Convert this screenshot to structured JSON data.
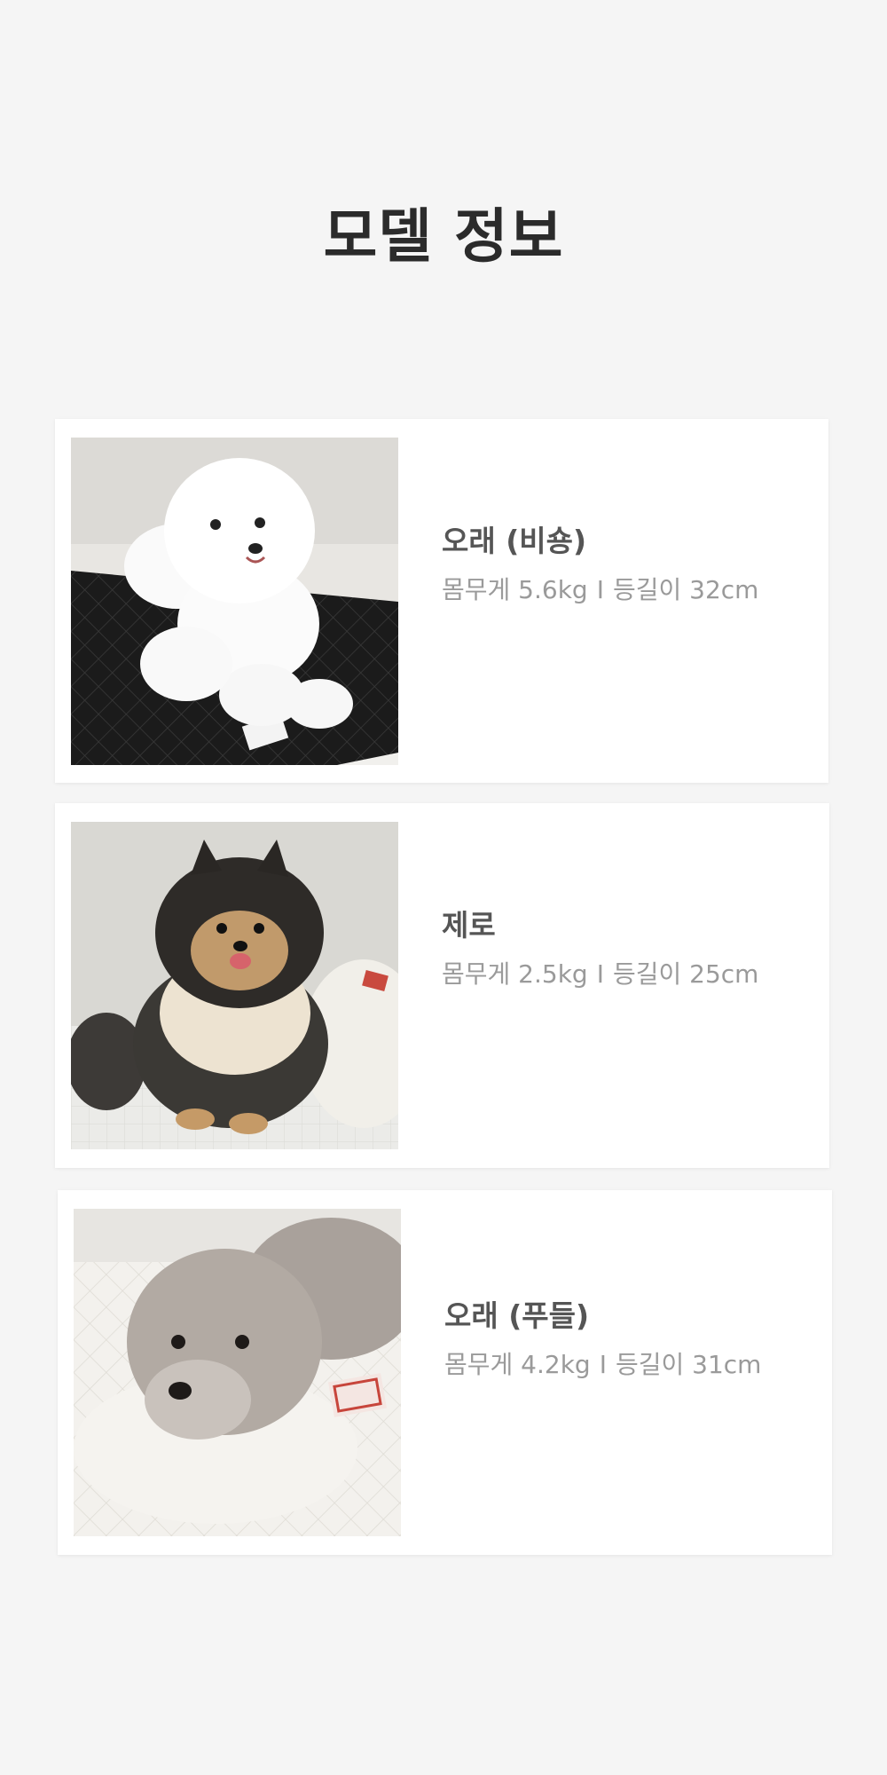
{
  "page": {
    "title": "모델 정보",
    "background": "#f5f5f5"
  },
  "models": [
    {
      "name": "오래 (비숑)",
      "weight": "몸무게 5.6kg",
      "separator": "I",
      "length": "등길이 32cm",
      "photo": "bichon-on-black-quilted-mat"
    },
    {
      "name": "제로",
      "weight": "몸무게 2.5kg",
      "separator": "I",
      "length": "등길이 25cm",
      "photo": "pomeranian-with-cushion"
    },
    {
      "name": "오래 (푸들)",
      "weight": "몸무게 4.2kg",
      "separator": "I",
      "length": "등길이 31cm",
      "photo": "poodle-on-white-pillow"
    }
  ],
  "colors": {
    "title": "#2b2b2b",
    "name": "#555555",
    "stats": "#9a9a9a",
    "card": "#ffffff"
  }
}
